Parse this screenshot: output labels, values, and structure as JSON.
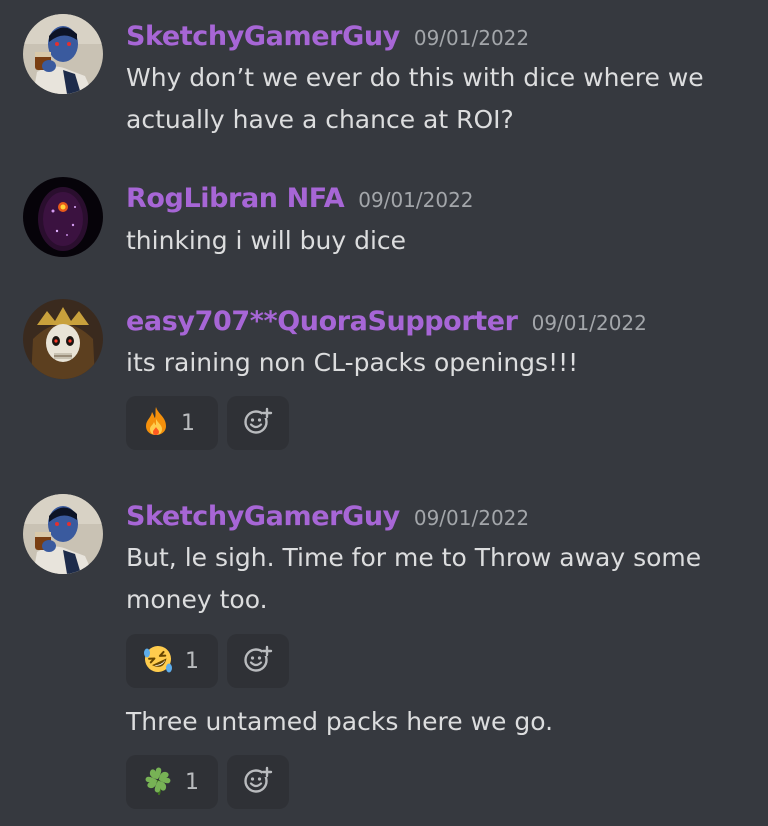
{
  "messages": [
    {
      "author": "SketchyGamerGuy",
      "timestamp": "09/01/2022",
      "lines": [
        "Why don’t we ever do this with dice where we",
        "actually have a chance at ROI?"
      ]
    },
    {
      "author": "RogLibran NFA",
      "timestamp": "09/01/2022",
      "lines": [
        "thinking i will buy dice"
      ]
    },
    {
      "author": "easy707**QuoraSupporter",
      "timestamp": "09/01/2022",
      "lines": [
        "its raining non CL-packs openings!!!"
      ],
      "reaction": {
        "emoji": "fire-emoji",
        "count": "1"
      }
    },
    {
      "author": "SketchyGamerGuy",
      "timestamp": "09/01/2022",
      "lines": [
        "But, le sigh. Time for me to Throw away some",
        "money too."
      ],
      "reaction": {
        "emoji": "rofl-emoji",
        "count": "1"
      },
      "followup": {
        "lines": [
          "Three untamed packs here we go."
        ],
        "reaction": {
          "emoji": "four-leaf-clover-emoji",
          "count": "1"
        }
      }
    }
  ],
  "colors": {
    "background": "#36393f",
    "author": "#a766d6",
    "timestamp": "#a3a6aa",
    "text": "#dcddde",
    "reaction_bg": "#2f3136"
  },
  "icons": {
    "add_reaction": "add-reaction-icon"
  }
}
